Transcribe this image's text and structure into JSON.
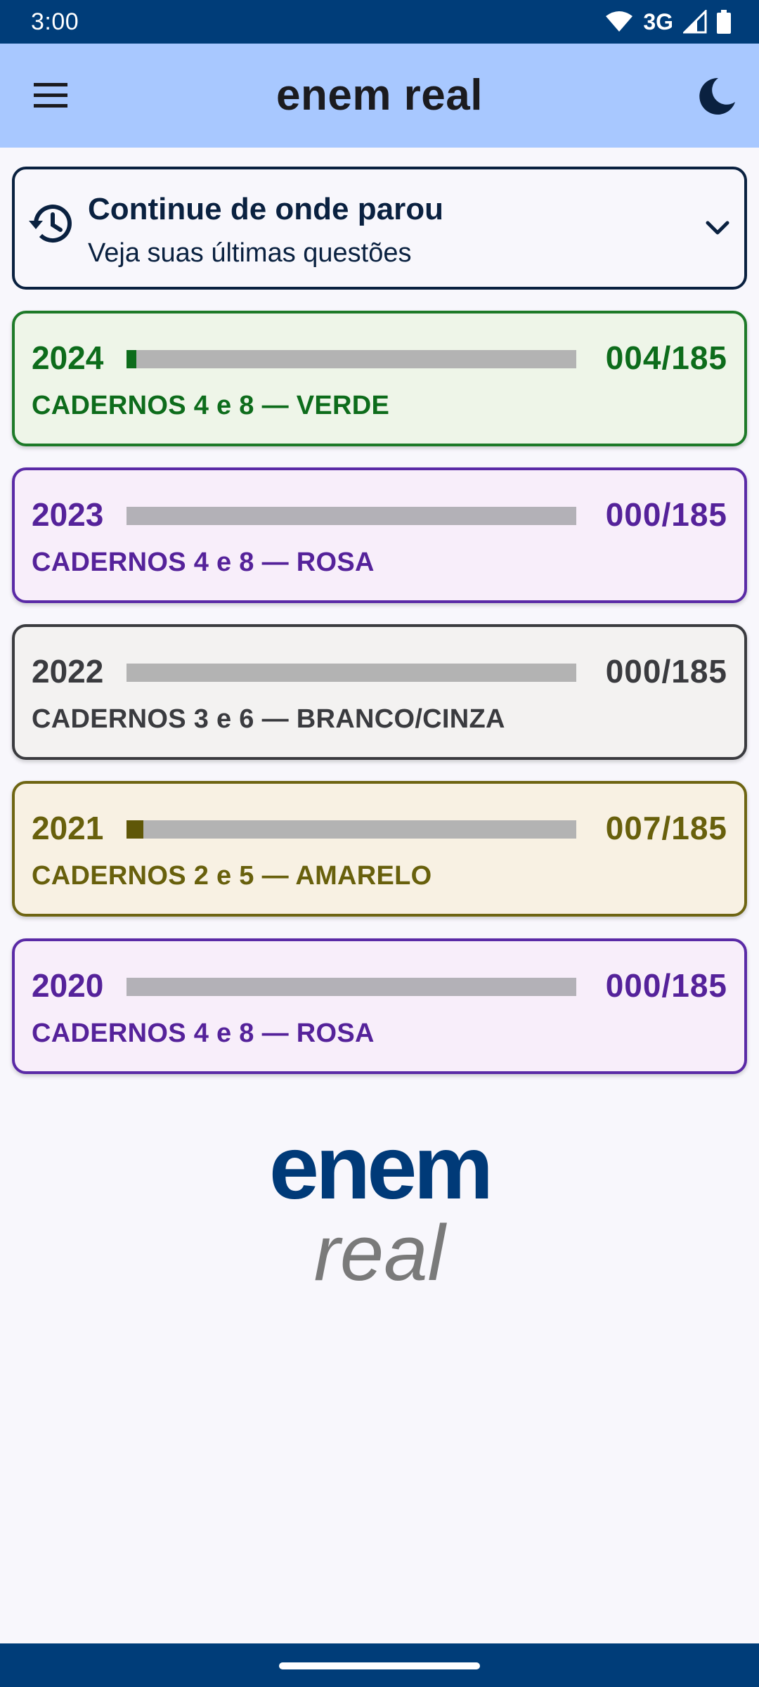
{
  "status_bar": {
    "time": "3:00",
    "network": "3G"
  },
  "app_bar": {
    "title": "enem real"
  },
  "continue": {
    "title": "Continue de onde parou",
    "subtitle": "Veja suas últimas questões"
  },
  "editions": [
    {
      "year": "2024",
      "count": "004/185",
      "subtitle": "CADERNOS 4 e 8 — VERDE",
      "progress": 0.0216,
      "color": "#0d6c1b"
    },
    {
      "year": "2023",
      "count": "000/185",
      "subtitle": "CADERNOS 4 e 8 — ROSA",
      "progress": 0,
      "color": "#55229a"
    },
    {
      "year": "2022",
      "count": "000/185",
      "subtitle": "CADERNOS 3 e 6 — BRANCO/CINZA",
      "progress": 0,
      "color": "#3a3b3f"
    },
    {
      "year": "2021",
      "count": "007/185",
      "subtitle": "CADERNOS 2 e 5 — AMARELO",
      "progress": 0.0378,
      "color": "#68600c"
    },
    {
      "year": "2020",
      "count": "000/185",
      "subtitle": "CADERNOS 4 e 8 — ROSA",
      "progress": 0,
      "color": "#55229a"
    }
  ],
  "logo": {
    "line1": "enem",
    "line2": "real"
  },
  "colors": {
    "status_bar": "#003d79",
    "app_bar": "#a8c8ff",
    "logo_blue": "#003a78",
    "logo_gray": "#7a7a7a"
  }
}
